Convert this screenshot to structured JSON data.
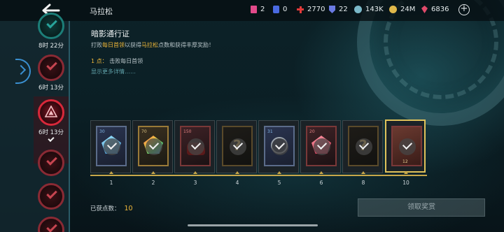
{
  "header": {
    "back_icon": "arrow-left-icon",
    "title": "马拉松",
    "resources": [
      {
        "icon": "ticket-icon",
        "color": "#e24a8a",
        "value": "2"
      },
      {
        "icon": "card-icon",
        "color": "#4a6ae2",
        "value": "0"
      },
      {
        "icon": "plus-cross-icon",
        "color": "#e23a3a",
        "value": "2770"
      },
      {
        "icon": "shield-icon",
        "color": "#6a7ae2",
        "value": "22"
      },
      {
        "icon": "orb-icon",
        "color": "#7ab8c8",
        "value": "143K"
      },
      {
        "icon": "coin-icon",
        "color": "#e0b84a",
        "value": "24M"
      },
      {
        "icon": "gem-icon",
        "color": "#e04a6a",
        "value": "6836"
      }
    ],
    "add_icon": "plus-circle-icon"
  },
  "sidebar": {
    "tiers": [
      {
        "time": "8时 22分",
        "state": "done-green"
      },
      {
        "time": "6时 13分",
        "state": "done"
      },
      {
        "time": "6时 13分",
        "state": "active"
      },
      {
        "time": "",
        "state": "done"
      },
      {
        "time": "",
        "state": "done"
      },
      {
        "time": "",
        "state": "done"
      }
    ]
  },
  "pass": {
    "title": "暗影通行证",
    "desc_prefix": "打败",
    "desc_hl1": "每日首领",
    "desc_mid": "以获得",
    "desc_hl2": "马拉松",
    "desc_suffix": "点数和获得丰厚奖励！",
    "point_num": "1 点：",
    "point_text": "击败每日首领",
    "more": "显示更多详情……"
  },
  "rewards": [
    {
      "level": "1",
      "amount": "30",
      "kind": "blue-shard",
      "claimed": true
    },
    {
      "level": "2",
      "amount": "70",
      "kind": "rainbow-shard",
      "claimed": true
    },
    {
      "level": "3",
      "amount": "150",
      "kind": "red-item",
      "claimed": true
    },
    {
      "level": "4",
      "amount": "",
      "kind": "mystery",
      "claimed": true
    },
    {
      "level": "5",
      "amount": "31",
      "kind": "blue-item",
      "claimed": true
    },
    {
      "level": "6",
      "amount": "20",
      "kind": "red-shard",
      "claimed": true
    },
    {
      "level": "8",
      "amount": "",
      "kind": "mystery",
      "claimed": true
    },
    {
      "level": "10",
      "amount": "12",
      "kind": "champion",
      "claimed": true
    }
  ],
  "footer": {
    "earned_label": "已获点数：",
    "earned_value": "10",
    "claim_label": "领取奖赏"
  }
}
